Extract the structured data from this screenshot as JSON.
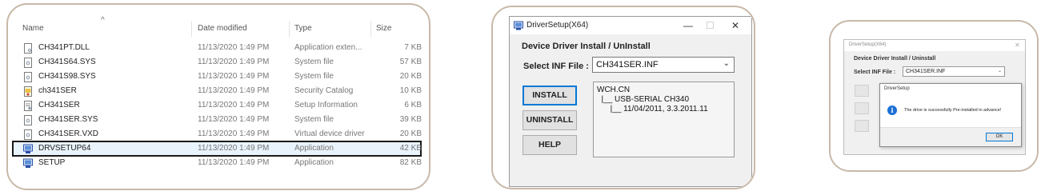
{
  "explorer": {
    "columns": {
      "name": "Name",
      "date": "Date modified",
      "type": "Type",
      "size": "Size"
    },
    "sort_indicator": "^",
    "rows": [
      {
        "name": "CH341PT.DLL",
        "date": "11/13/2020 1:49 PM",
        "type": "Application exten...",
        "size": "7 KB",
        "icon": "dll-file-icon"
      },
      {
        "name": "CH341S64.SYS",
        "date": "11/13/2020 1:49 PM",
        "type": "System file",
        "size": "57 KB",
        "icon": "system-file-icon"
      },
      {
        "name": "CH341S98.SYS",
        "date": "11/13/2020 1:49 PM",
        "type": "System file",
        "size": "20 KB",
        "icon": "system-file-icon"
      },
      {
        "name": "ch341SER",
        "date": "11/13/2020 1:49 PM",
        "type": "Security Catalog",
        "size": "10 KB",
        "icon": "security-catalog-icon"
      },
      {
        "name": "CH341SER",
        "date": "11/13/2020 1:49 PM",
        "type": "Setup Information",
        "size": "6 KB",
        "icon": "setup-info-icon"
      },
      {
        "name": "CH341SER.SYS",
        "date": "11/13/2020 1:49 PM",
        "type": "System file",
        "size": "39 KB",
        "icon": "system-file-icon"
      },
      {
        "name": "CH341SER.VXD",
        "date": "11/13/2020 1:49 PM",
        "type": "Virtual device driver",
        "size": "20 KB",
        "icon": "system-file-icon"
      },
      {
        "name": "DRVSETUP64",
        "date": "11/13/2020 1:49 PM",
        "type": "Application",
        "size": "42 KB",
        "icon": "setup-app-icon",
        "selected": true
      },
      {
        "name": "SETUP",
        "date": "11/13/2020 1:49 PM",
        "type": "Application",
        "size": "82 KB",
        "icon": "setup-app-icon"
      }
    ]
  },
  "driver_setup": {
    "title": "DriverSetup(X64)",
    "controls": {
      "minimize": "—",
      "maximize": "☐",
      "close": "✕"
    },
    "heading": "Device Driver Install / UnInstall",
    "select_label": "Select INF File :",
    "select_value": "CH341SER.INF",
    "buttons": {
      "install": "INSTALL",
      "uninstall": "UNINSTALL",
      "help": "HELP"
    },
    "output_lines": [
      "WCH.CN",
      "  |__ USB-SERIAL CH340",
      "      |__ 11/04/2011, 3.3.2011.11"
    ]
  },
  "dialog_window": {
    "title": "DriverSetup(X64)",
    "close": "✕",
    "heading": "Device Driver Install / Uninstall",
    "select_label": "Select INF File :",
    "select_value": "CH341SER.INF",
    "dialog": {
      "title": "DriverSetup",
      "message": "The drive is successfully Pre-installed in advance!",
      "ok": "OK",
      "icon": "info-icon"
    }
  },
  "colors": {
    "panel_border": "#c8b9a8",
    "focus_blue": "#0078d7",
    "selection_bg": "#e9f3fb"
  }
}
